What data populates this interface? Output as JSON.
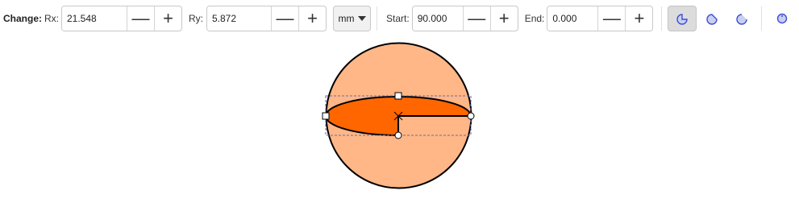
{
  "toolbar": {
    "change_label": "Change:",
    "rx_label": "Rx:",
    "rx_value": "21.548",
    "ry_label": "Ry:",
    "ry_value": "5.872",
    "unit": "mm",
    "start_label": "Start:",
    "start_value": "90.000",
    "end_label": "End:",
    "end_value": "0.000",
    "decrement_symbol": "—",
    "increment_symbol": "+",
    "arc_type_buttons": [
      {
        "name": "slice-icon",
        "active": true
      },
      {
        "name": "arc-closed-icon",
        "active": false
      },
      {
        "name": "arc-open-icon",
        "active": false
      },
      {
        "name": "make-whole-icon",
        "active": false
      }
    ]
  },
  "colors": {
    "circle_fill": "#ffb787",
    "slice_fill": "#ff6600",
    "stroke": "#000000",
    "icon_blue": "#3c4fd6",
    "icon_fill": "#c9cfee"
  }
}
